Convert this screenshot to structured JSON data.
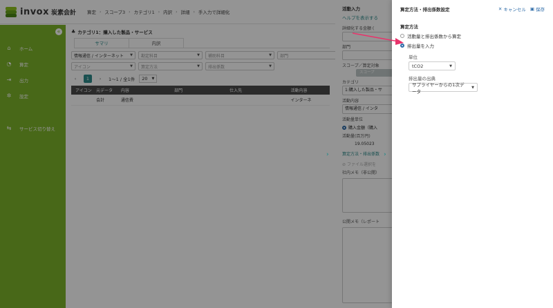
{
  "app": {
    "logo_text": "invox",
    "logo_sub": "炭素会計"
  },
  "breadcrumb": [
    "算定",
    "スコープ3",
    "カテゴリ1",
    "内訳",
    "詳細",
    "手入力で詳細化"
  ],
  "sidebar": {
    "collapse_glyph": "«",
    "items": [
      {
        "label": "ホーム",
        "icon": "home-icon",
        "glyph": "⌂"
      },
      {
        "label": "算定",
        "icon": "clock-icon",
        "glyph": "◔"
      },
      {
        "label": "出力",
        "icon": "export-icon",
        "glyph": "⇥"
      },
      {
        "label": "設定",
        "icon": "gear-icon",
        "glyph": "✲"
      },
      {
        "label": "サービス切り替え",
        "icon": "switch-icon",
        "glyph": "⇆"
      }
    ]
  },
  "main": {
    "title": "カテゴリ1：購入した製品・サービス",
    "tabs": [
      "サマリ",
      "内訳"
    ],
    "filters": [
      {
        "text": "情報通信 / インターネット",
        "filled": true
      },
      {
        "text": "勘定科目",
        "filled": false
      },
      {
        "text": "補助科目",
        "filled": false
      },
      {
        "text": "部門",
        "filled": false
      },
      {
        "text": "アイコン",
        "filled": false
      },
      {
        "text": "算定方法",
        "filled": false
      },
      {
        "text": "排出係数",
        "filled": false
      }
    ],
    "pager": {
      "page": "1",
      "range": "1〜1 / 全1件",
      "size": "20"
    },
    "columns": [
      "アイコン",
      "元データ",
      "内容",
      "部門",
      "仕入先",
      "活動内容"
    ],
    "rows": [
      [
        "",
        "会計",
        "通信費",
        "",
        "",
        "インターネ"
      ]
    ]
  },
  "middle": {
    "title": "活動入力",
    "help_link": "ヘルプを表示する",
    "detail_label": "詳細化する金額 (",
    "dept_label": "部門",
    "scope_label": "スコープ／算定対象",
    "scope_button": "スコープ",
    "category_label": "カテゴリ",
    "category_value": "1:購入した製品・サ",
    "activity_label": "活動内容",
    "activity_value": "情報通信 / インタ",
    "unit_label": "活動量単位",
    "unit_option": "購入金額（購入",
    "amount_label": "活動量(百万円)",
    "amount_value": "19.05023",
    "method_link": "算定方法・排出係数",
    "file_select": "ファイル選択を",
    "memo_private": "社内メモ（非公開）",
    "memo_public": "公開メモ（レポート"
  },
  "panel": {
    "title": "算定方法・排出係数設定",
    "cancel": "キャンセル",
    "save": "保存",
    "method_label": "算定方法",
    "options": [
      "活動量と排出係数から算定",
      "排出量を入力"
    ],
    "selected_option": 1,
    "unit_label": "単位",
    "unit_value": "tCO2",
    "source_label": "排出量の出典",
    "source_value": "サプライヤーからの1次データ"
  },
  "colors": {
    "brand_green": "#7db32a",
    "accent_teal": "#2d8b8b",
    "link_blue": "#2d6ba8",
    "arrow_pink": "#e8336b"
  }
}
